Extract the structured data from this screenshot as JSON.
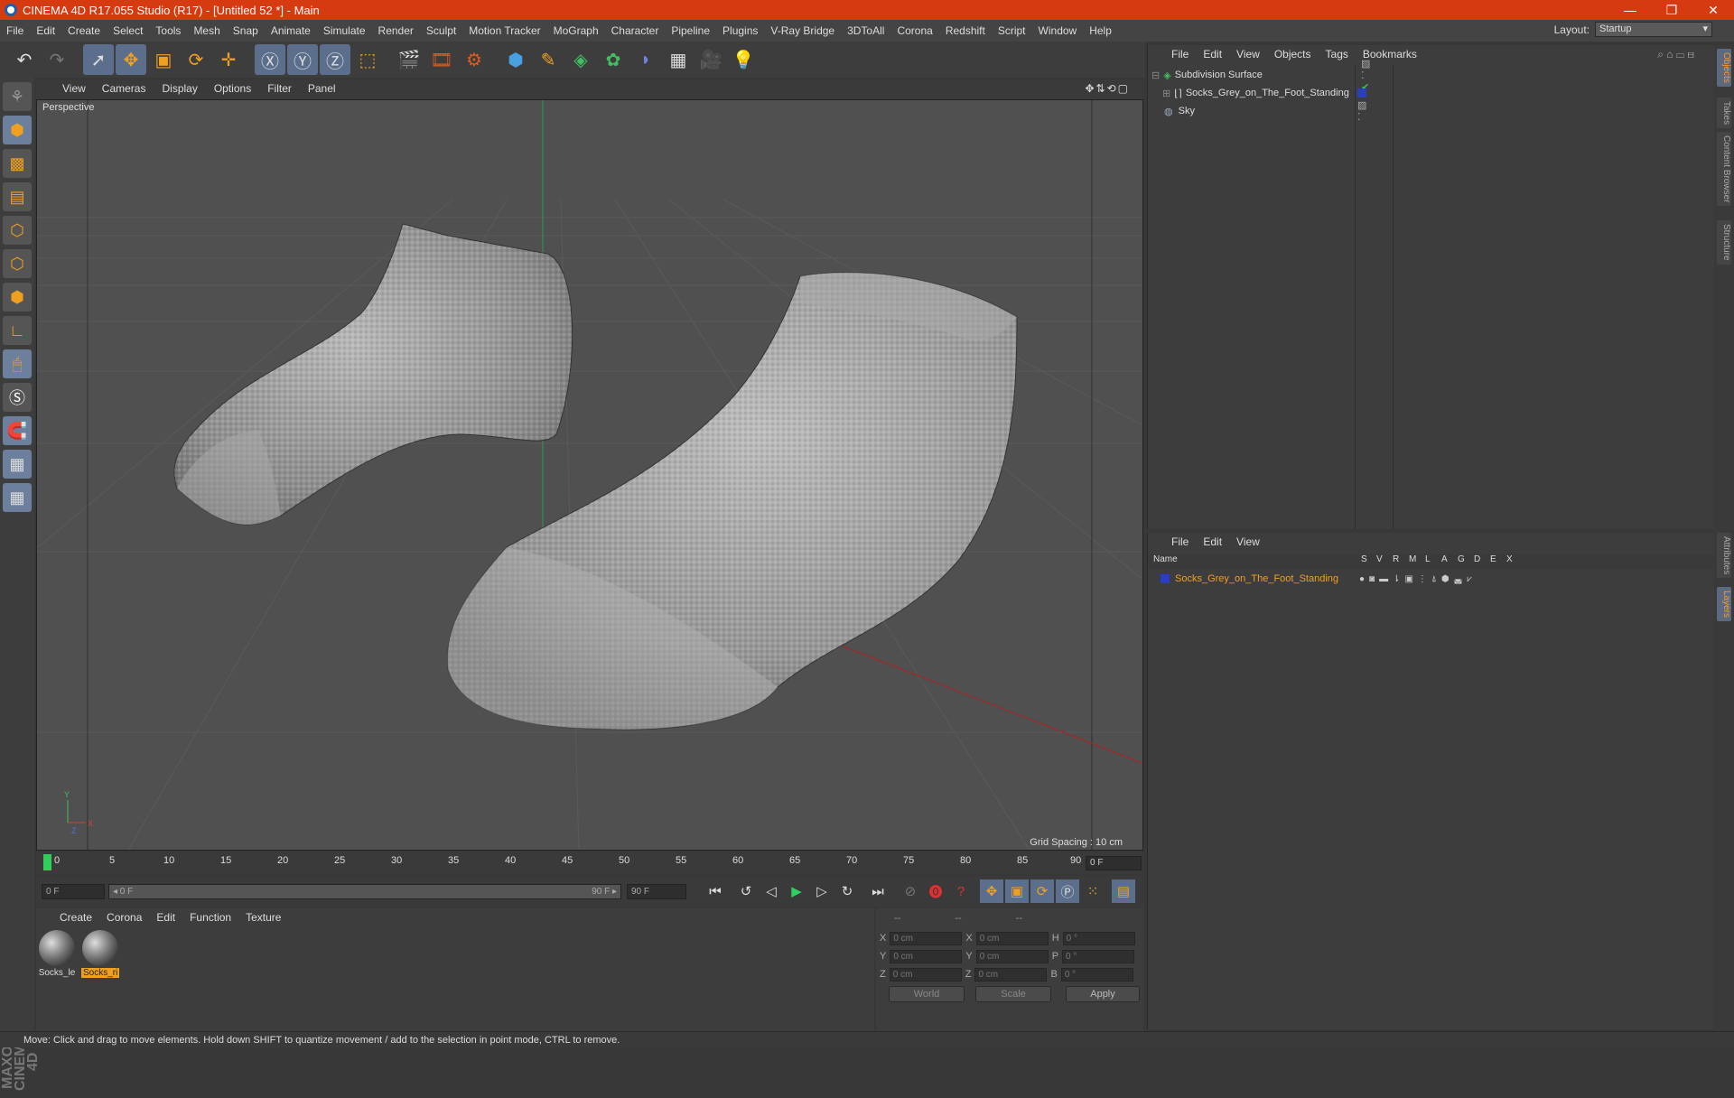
{
  "window": {
    "title": "CINEMA 4D R17.055 Studio (R17) - [Untitled 52 *] - Main",
    "minimize": "—",
    "maximize": "❐",
    "close": "✕"
  },
  "menu": [
    "File",
    "Edit",
    "Create",
    "Select",
    "Tools",
    "Mesh",
    "Snap",
    "Animate",
    "Simulate",
    "Render",
    "Sculpt",
    "Motion Tracker",
    "MoGraph",
    "Character",
    "Pipeline",
    "Plugins",
    "V-Ray Bridge",
    "3DToAll",
    "Corona",
    "Redshift",
    "Script",
    "Window",
    "Help"
  ],
  "layout": {
    "label": "Layout:",
    "value": "Startup"
  },
  "viewport": {
    "menu": [
      "View",
      "Cameras",
      "Display",
      "Options",
      "Filter",
      "Panel"
    ],
    "label": "Perspective",
    "grid_spacing": "Grid Spacing : 10 cm"
  },
  "timeline": {
    "ticks": [
      "0",
      "5",
      "10",
      "15",
      "20",
      "25",
      "30",
      "35",
      "40",
      "45",
      "50",
      "55",
      "60",
      "65",
      "70",
      "75",
      "80",
      "85",
      "90"
    ],
    "current_frame": "0 F"
  },
  "transport": {
    "start": "0 F",
    "range_start": "◂ 0 F",
    "range_end": "90 F ▸",
    "end": "90 F"
  },
  "material_panel": {
    "menu": [
      "Create",
      "Corona",
      "Edit",
      "Function",
      "Texture"
    ],
    "materials": [
      {
        "name": "Socks_le",
        "selected": false
      },
      {
        "name": "Socks_ri",
        "selected": true
      }
    ]
  },
  "coordinates": {
    "headers": [
      "--",
      "--",
      "--"
    ],
    "rows": [
      {
        "a": "X",
        "av": "0 cm",
        "b": "X",
        "bv": "0 cm",
        "c": "H",
        "cv": "0 °"
      },
      {
        "a": "Y",
        "av": "0 cm",
        "b": "Y",
        "bv": "0 cm",
        "c": "P",
        "cv": "0 °"
      },
      {
        "a": "Z",
        "av": "0 cm",
        "b": "Z",
        "bv": "0 cm",
        "c": "B",
        "cv": "0 °"
      }
    ],
    "world": "World",
    "scale": "Scale",
    "apply": "Apply"
  },
  "object_manager": {
    "menu": [
      "File",
      "Edit",
      "View",
      "Objects",
      "Tags",
      "Bookmarks"
    ],
    "objects": [
      {
        "name": "Subdivision Surface",
        "level": 0
      },
      {
        "name": "Socks_Grey_on_The_Foot_Standing",
        "level": 1
      },
      {
        "name": "Sky",
        "level": 0
      }
    ]
  },
  "layer_manager": {
    "menu": [
      "File",
      "Edit",
      "View"
    ],
    "columns": [
      "Name",
      "S",
      "V",
      "R",
      "M",
      "L",
      "A",
      "G",
      "D",
      "E",
      "X"
    ],
    "layers": [
      {
        "name": "Socks_Grey_on_The_Foot_Standing",
        "color": "#2a3fc0"
      }
    ]
  },
  "side_tabs": [
    "Objects",
    "Takes",
    "Content Browser",
    "Structure",
    "Attributes",
    "Layers"
  ],
  "status": "Move: Click and drag to move elements. Hold down SHIFT to quantize movement / add to the selection in point mode, CTRL to remove.",
  "colors": {
    "titlebar": "#d63a10",
    "highlight": "#ff9a2a",
    "layer_selected_text": "#f0a020"
  },
  "logo": "MAXON CINEMA 4D"
}
